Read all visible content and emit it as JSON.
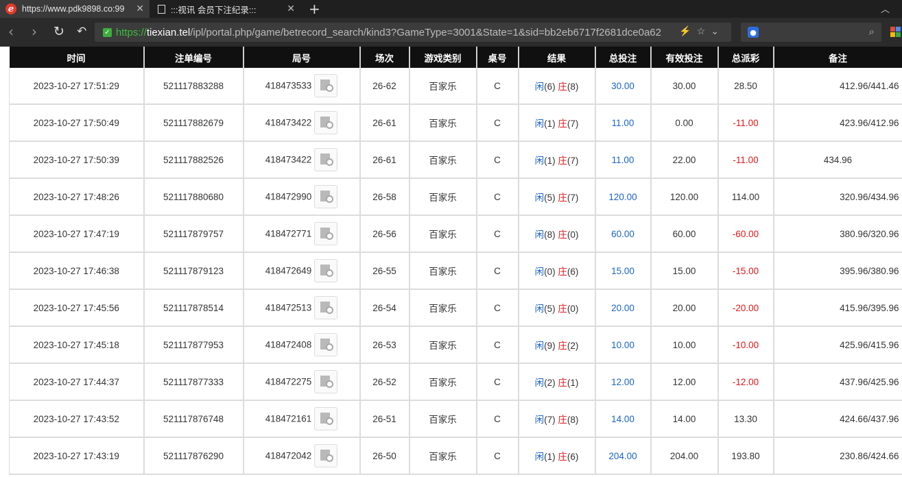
{
  "browser": {
    "tabs": [
      {
        "title": "https://www.pdk9898.co:99",
        "icon": "ie-logo-icon"
      },
      {
        "title": ":::视讯 会员下注纪录:::",
        "icon": "document-icon"
      }
    ],
    "url": {
      "scheme": "https://",
      "host": "tiexian.tel",
      "rest": "/ipl/portal.php/game/betrecord_search/kind3?GameType=3001&State=1&sid=bb2eb6717f2681dce0a62"
    }
  },
  "table": {
    "headers": [
      "时间",
      "注单编号",
      "局号",
      "场次",
      "游戏类别",
      "桌号",
      "结果",
      "总投注",
      "有效投注",
      "总派彩",
      "备注"
    ],
    "result_player_label": "闲",
    "result_banker_label": "庄",
    "rows": [
      {
        "time": "2023-10-27 17:51:29",
        "bet_id": "521117883288",
        "round": "418473533",
        "session": "26-62",
        "game": "百家乐",
        "table": "C",
        "player": "(6)",
        "banker": "(8)",
        "total_bet": "30.00",
        "valid_bet": "30.00",
        "payout": "28.50",
        "payout_negative": false,
        "remark": "412.96/441.46"
      },
      {
        "time": "2023-10-27 17:50:49",
        "bet_id": "521117882679",
        "round": "418473422",
        "session": "26-61",
        "game": "百家乐",
        "table": "C",
        "player": "(1)",
        "banker": "(7)",
        "total_bet": "11.00",
        "valid_bet": "0.00",
        "payout": "-11.00",
        "payout_negative": true,
        "remark": "423.96/412.96"
      },
      {
        "time": "2023-10-27 17:50:39",
        "bet_id": "521117882526",
        "round": "418473422",
        "session": "26-61",
        "game": "百家乐",
        "table": "C",
        "player": "(1)",
        "banker": "(7)",
        "total_bet": "11.00",
        "valid_bet": "22.00",
        "payout": "-11.00",
        "payout_negative": true,
        "remark": "434.96"
      },
      {
        "time": "2023-10-27 17:48:26",
        "bet_id": "521117880680",
        "round": "418472990",
        "session": "26-58",
        "game": "百家乐",
        "table": "C",
        "player": "(5)",
        "banker": "(7)",
        "total_bet": "120.00",
        "valid_bet": "120.00",
        "payout": "114.00",
        "payout_negative": false,
        "remark": "320.96/434.96"
      },
      {
        "time": "2023-10-27 17:47:19",
        "bet_id": "521117879757",
        "round": "418472771",
        "session": "26-56",
        "game": "百家乐",
        "table": "C",
        "player": "(8)",
        "banker": "(0)",
        "total_bet": "60.00",
        "valid_bet": "60.00",
        "payout": "-60.00",
        "payout_negative": true,
        "remark": "380.96/320.96"
      },
      {
        "time": "2023-10-27 17:46:38",
        "bet_id": "521117879123",
        "round": "418472649",
        "session": "26-55",
        "game": "百家乐",
        "table": "C",
        "player": "(0)",
        "banker": "(6)",
        "total_bet": "15.00",
        "valid_bet": "15.00",
        "payout": "-15.00",
        "payout_negative": true,
        "remark": "395.96/380.96"
      },
      {
        "time": "2023-10-27 17:45:56",
        "bet_id": "521117878514",
        "round": "418472513",
        "session": "26-54",
        "game": "百家乐",
        "table": "C",
        "player": "(5)",
        "banker": "(0)",
        "total_bet": "20.00",
        "valid_bet": "20.00",
        "payout": "-20.00",
        "payout_negative": true,
        "remark": "415.96/395.96"
      },
      {
        "time": "2023-10-27 17:45:18",
        "bet_id": "521117877953",
        "round": "418472408",
        "session": "26-53",
        "game": "百家乐",
        "table": "C",
        "player": "(9)",
        "banker": "(2)",
        "total_bet": "10.00",
        "valid_bet": "10.00",
        "payout": "-10.00",
        "payout_negative": true,
        "remark": "425.96/415.96"
      },
      {
        "time": "2023-10-27 17:44:37",
        "bet_id": "521117877333",
        "round": "418472275",
        "session": "26-52",
        "game": "百家乐",
        "table": "C",
        "player": "(2)",
        "banker": "(1)",
        "total_bet": "12.00",
        "valid_bet": "12.00",
        "payout": "-12.00",
        "payout_negative": true,
        "remark": "437.96/425.96"
      },
      {
        "time": "2023-10-27 17:43:52",
        "bet_id": "521117876748",
        "round": "418472161",
        "session": "26-51",
        "game": "百家乐",
        "table": "C",
        "player": "(7)",
        "banker": "(8)",
        "total_bet": "14.00",
        "valid_bet": "14.00",
        "payout": "13.30",
        "payout_negative": false,
        "remark": "424.66/437.96"
      },
      {
        "time": "2023-10-27 17:43:19",
        "bet_id": "521117876290",
        "round": "418472042",
        "session": "26-50",
        "game": "百家乐",
        "table": "C",
        "player": "(1)",
        "banker": "(6)",
        "total_bet": "204.00",
        "valid_bet": "204.00",
        "payout": "193.80",
        "payout_negative": false,
        "remark": "230.86/424.66"
      }
    ]
  },
  "colors": {
    "link_blue": "#1a63c6",
    "negative_red": "#e0181b",
    "header_bg": "#101010"
  }
}
